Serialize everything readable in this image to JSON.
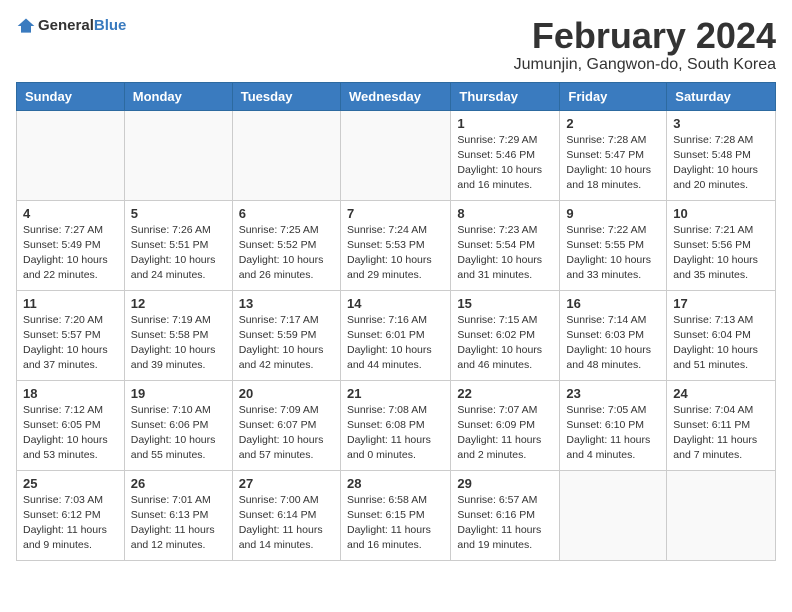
{
  "header": {
    "logo_general": "General",
    "logo_blue": "Blue",
    "month_year": "February 2024",
    "location": "Jumunjin, Gangwon-do, South Korea"
  },
  "weekdays": [
    "Sunday",
    "Monday",
    "Tuesday",
    "Wednesday",
    "Thursday",
    "Friday",
    "Saturday"
  ],
  "weeks": [
    [
      {
        "day": "",
        "info": ""
      },
      {
        "day": "",
        "info": ""
      },
      {
        "day": "",
        "info": ""
      },
      {
        "day": "",
        "info": ""
      },
      {
        "day": "1",
        "info": "Sunrise: 7:29 AM\nSunset: 5:46 PM\nDaylight: 10 hours\nand 16 minutes."
      },
      {
        "day": "2",
        "info": "Sunrise: 7:28 AM\nSunset: 5:47 PM\nDaylight: 10 hours\nand 18 minutes."
      },
      {
        "day": "3",
        "info": "Sunrise: 7:28 AM\nSunset: 5:48 PM\nDaylight: 10 hours\nand 20 minutes."
      }
    ],
    [
      {
        "day": "4",
        "info": "Sunrise: 7:27 AM\nSunset: 5:49 PM\nDaylight: 10 hours\nand 22 minutes."
      },
      {
        "day": "5",
        "info": "Sunrise: 7:26 AM\nSunset: 5:51 PM\nDaylight: 10 hours\nand 24 minutes."
      },
      {
        "day": "6",
        "info": "Sunrise: 7:25 AM\nSunset: 5:52 PM\nDaylight: 10 hours\nand 26 minutes."
      },
      {
        "day": "7",
        "info": "Sunrise: 7:24 AM\nSunset: 5:53 PM\nDaylight: 10 hours\nand 29 minutes."
      },
      {
        "day": "8",
        "info": "Sunrise: 7:23 AM\nSunset: 5:54 PM\nDaylight: 10 hours\nand 31 minutes."
      },
      {
        "day": "9",
        "info": "Sunrise: 7:22 AM\nSunset: 5:55 PM\nDaylight: 10 hours\nand 33 minutes."
      },
      {
        "day": "10",
        "info": "Sunrise: 7:21 AM\nSunset: 5:56 PM\nDaylight: 10 hours\nand 35 minutes."
      }
    ],
    [
      {
        "day": "11",
        "info": "Sunrise: 7:20 AM\nSunset: 5:57 PM\nDaylight: 10 hours\nand 37 minutes."
      },
      {
        "day": "12",
        "info": "Sunrise: 7:19 AM\nSunset: 5:58 PM\nDaylight: 10 hours\nand 39 minutes."
      },
      {
        "day": "13",
        "info": "Sunrise: 7:17 AM\nSunset: 5:59 PM\nDaylight: 10 hours\nand 42 minutes."
      },
      {
        "day": "14",
        "info": "Sunrise: 7:16 AM\nSunset: 6:01 PM\nDaylight: 10 hours\nand 44 minutes."
      },
      {
        "day": "15",
        "info": "Sunrise: 7:15 AM\nSunset: 6:02 PM\nDaylight: 10 hours\nand 46 minutes."
      },
      {
        "day": "16",
        "info": "Sunrise: 7:14 AM\nSunset: 6:03 PM\nDaylight: 10 hours\nand 48 minutes."
      },
      {
        "day": "17",
        "info": "Sunrise: 7:13 AM\nSunset: 6:04 PM\nDaylight: 10 hours\nand 51 minutes."
      }
    ],
    [
      {
        "day": "18",
        "info": "Sunrise: 7:12 AM\nSunset: 6:05 PM\nDaylight: 10 hours\nand 53 minutes."
      },
      {
        "day": "19",
        "info": "Sunrise: 7:10 AM\nSunset: 6:06 PM\nDaylight: 10 hours\nand 55 minutes."
      },
      {
        "day": "20",
        "info": "Sunrise: 7:09 AM\nSunset: 6:07 PM\nDaylight: 10 hours\nand 57 minutes."
      },
      {
        "day": "21",
        "info": "Sunrise: 7:08 AM\nSunset: 6:08 PM\nDaylight: 11 hours\nand 0 minutes."
      },
      {
        "day": "22",
        "info": "Sunrise: 7:07 AM\nSunset: 6:09 PM\nDaylight: 11 hours\nand 2 minutes."
      },
      {
        "day": "23",
        "info": "Sunrise: 7:05 AM\nSunset: 6:10 PM\nDaylight: 11 hours\nand 4 minutes."
      },
      {
        "day": "24",
        "info": "Sunrise: 7:04 AM\nSunset: 6:11 PM\nDaylight: 11 hours\nand 7 minutes."
      }
    ],
    [
      {
        "day": "25",
        "info": "Sunrise: 7:03 AM\nSunset: 6:12 PM\nDaylight: 11 hours\nand 9 minutes."
      },
      {
        "day": "26",
        "info": "Sunrise: 7:01 AM\nSunset: 6:13 PM\nDaylight: 11 hours\nand 12 minutes."
      },
      {
        "day": "27",
        "info": "Sunrise: 7:00 AM\nSunset: 6:14 PM\nDaylight: 11 hours\nand 14 minutes."
      },
      {
        "day": "28",
        "info": "Sunrise: 6:58 AM\nSunset: 6:15 PM\nDaylight: 11 hours\nand 16 minutes."
      },
      {
        "day": "29",
        "info": "Sunrise: 6:57 AM\nSunset: 6:16 PM\nDaylight: 11 hours\nand 19 minutes."
      },
      {
        "day": "",
        "info": ""
      },
      {
        "day": "",
        "info": ""
      }
    ]
  ]
}
